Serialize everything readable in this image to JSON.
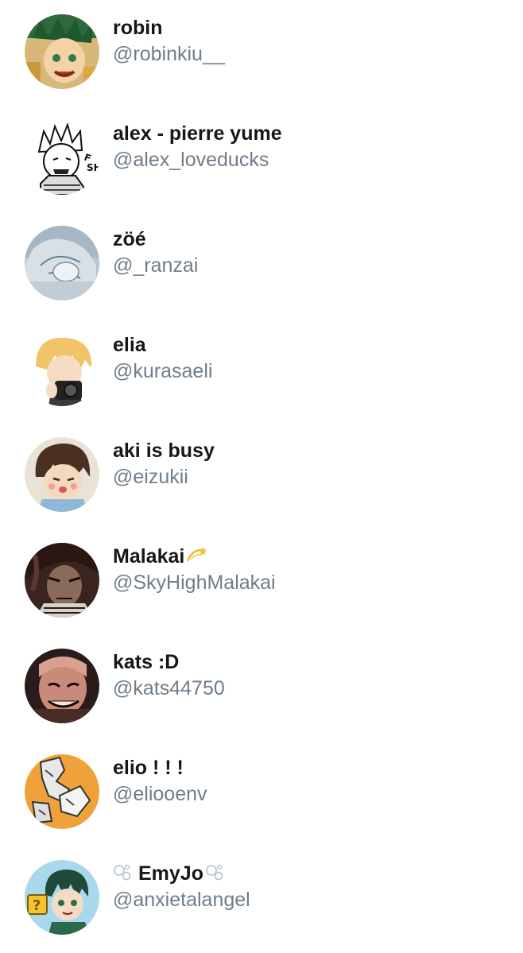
{
  "accounts": [
    {
      "name": "robin",
      "handle": "@robinkiu__"
    },
    {
      "name": "alex - pierre yume",
      "handle": "@alex_loveducks"
    },
    {
      "name": "zöé",
      "handle": "@_ranzai"
    },
    {
      "name": "elia",
      "handle": "@kurasaeli"
    },
    {
      "name": "aki is busy",
      "handle": "@eizukii"
    },
    {
      "name": "Malakai",
      "handle": "@SkyHighMalakai",
      "suffix_icon": "dizzy-icon"
    },
    {
      "name": "kats :D",
      "handle": "@kats44750"
    },
    {
      "name": "elio ! ! !",
      "handle": "@eliooenv"
    },
    {
      "name": "EmyJo",
      "handle": "@anxietalangel",
      "prefix_icon": "bubbles-icon",
      "suffix_icon": "bubbles-icon"
    }
  ],
  "colors": {
    "name_text": "#14171a",
    "handle_text": "#6f7d89",
    "background": "#ffffff"
  }
}
